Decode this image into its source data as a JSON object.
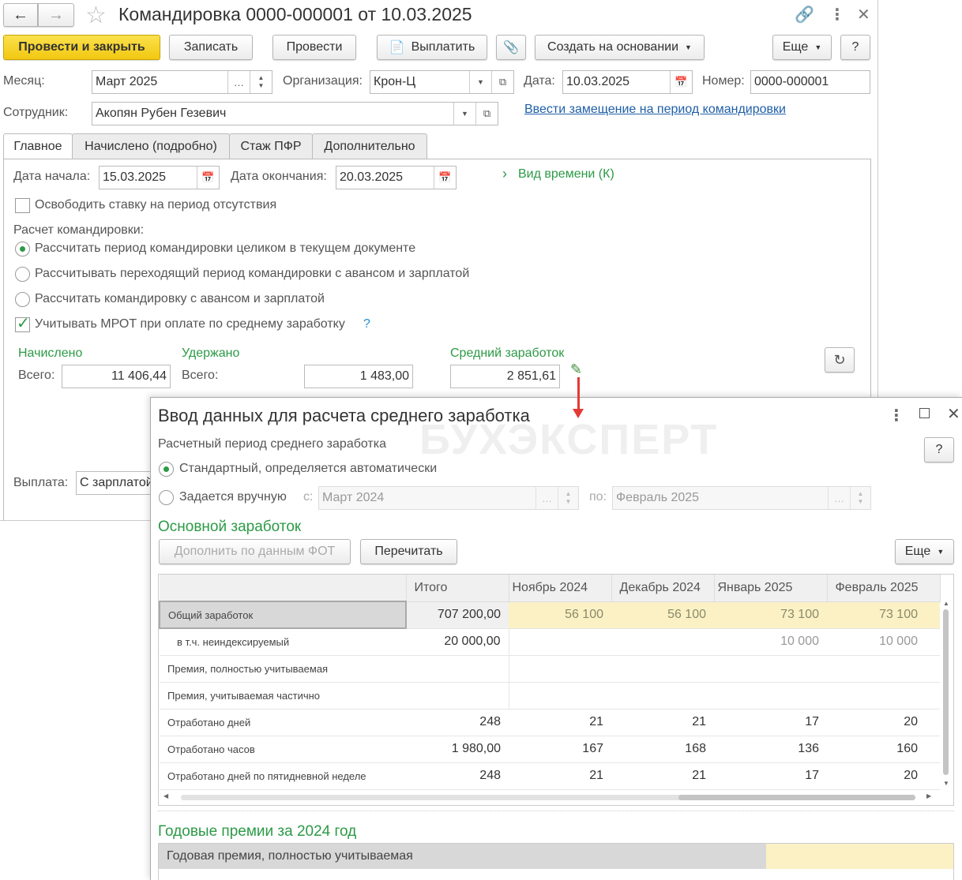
{
  "window": {
    "title": "Командировка 0000-000001 от 10.03.2025"
  },
  "toolbar": {
    "post_close": "Провести и закрыть",
    "save": "Записать",
    "post": "Провести",
    "pay": "Выплатить",
    "create_based": "Создать на основании",
    "more": "Еще",
    "help": "?"
  },
  "header": {
    "month_label": "Месяц:",
    "month_value": "Март 2025",
    "org_label": "Организация:",
    "org_value": "Крон-Ц",
    "date_label": "Дата:",
    "date_value": "10.03.2025",
    "number_label": "Номер:",
    "number_value": "0000-000001",
    "employee_label": "Сотрудник:",
    "employee_value": "Акопян Рубен Гезевич",
    "substitute_link": "Ввести замещение на период командировки"
  },
  "tabs": [
    "Главное",
    "Начислено (подробно)",
    "Стаж ПФР",
    "Дополнительно"
  ],
  "main": {
    "start_label": "Дата начала:",
    "start_value": "15.03.2025",
    "end_label": "Дата окончания:",
    "end_value": "20.03.2025",
    "time_kind": "Вид времени (К)",
    "free_rate": "Освободить ставку на период отсутствия",
    "calc_label": "Расчет командировки:",
    "options": [
      "Рассчитать период командировки целиком в текущем документе",
      "Рассчитывать переходящий период командировки с авансом и зарплатой",
      "Рассчитать командировку с авансом и зарплатой"
    ],
    "mrot_label": "Учитывать МРОТ при оплате по среднему заработку",
    "mrot_help": "?",
    "accrued_title": "Начислено",
    "accrued_total_label": "Всего:",
    "accrued_total": "11 406,44",
    "withheld_title": "Удержано",
    "withheld_total_label": "Всего:",
    "withheld_total": "1 483,00",
    "avg_title": "Средний заработок",
    "avg_value": "2 851,61",
    "payment_label": "Выплата:",
    "payment_value": "С зарплатой"
  },
  "dialog": {
    "title": "Ввод данных для расчета среднего заработка",
    "watermark": "БУХЭКСПЕРТ",
    "period_label": "Расчетный период среднего заработка",
    "period_auto": "Стандартный, определяется автоматически",
    "period_manual": "Задается вручную",
    "from_label": "с:",
    "from_value": "Март 2024",
    "to_label": "по:",
    "to_value": "Февраль 2025",
    "help": "?",
    "main_earnings_title": "Основной заработок",
    "fill_fot": "Дополнить по данным ФОТ",
    "recalc": "Перечитать",
    "more": "Еще",
    "columns": [
      "",
      "Итого",
      "Ноябрь 2024",
      "Декабрь 2024",
      "Январь 2025",
      "Февраль 2025"
    ],
    "rows": [
      {
        "label": "Общий заработок",
        "total": "707 200,00",
        "m1": "56 100",
        "m2": "56 100",
        "m3": "73 100",
        "m4": "73 100"
      },
      {
        "label": "в т.ч. неиндексируемый",
        "total": "20 000,00",
        "m1": "",
        "m2": "",
        "m3": "10 000",
        "m4": "10 000"
      },
      {
        "label": "Премия, полностью учитываемая",
        "total": "",
        "m1": "",
        "m2": "",
        "m3": "",
        "m4": ""
      },
      {
        "label": "Премия, учитываемая частично",
        "total": "",
        "m1": "",
        "m2": "",
        "m3": "",
        "m4": ""
      },
      {
        "label": "Отработано дней",
        "total": "248",
        "m1": "21",
        "m2": "21",
        "m3": "17",
        "m4": "20"
      },
      {
        "label": "Отработано часов",
        "total": "1 980,00",
        "m1": "167",
        "m2": "168",
        "m3": "136",
        "m4": "160"
      },
      {
        "label": "Отработано дней по пятидневной неделе",
        "total": "248",
        "m1": "21",
        "m2": "21",
        "m3": "17",
        "m4": "20"
      }
    ],
    "annual_title": "Годовые премии за 2024 год",
    "annual_row": "Годовая премия, полностью учитываемая"
  },
  "colors": {
    "accent_green": "#2c9a46",
    "primary_yellow": "#f2c811",
    "link_blue": "#1f5fa8",
    "arrow_red": "#e53935"
  }
}
